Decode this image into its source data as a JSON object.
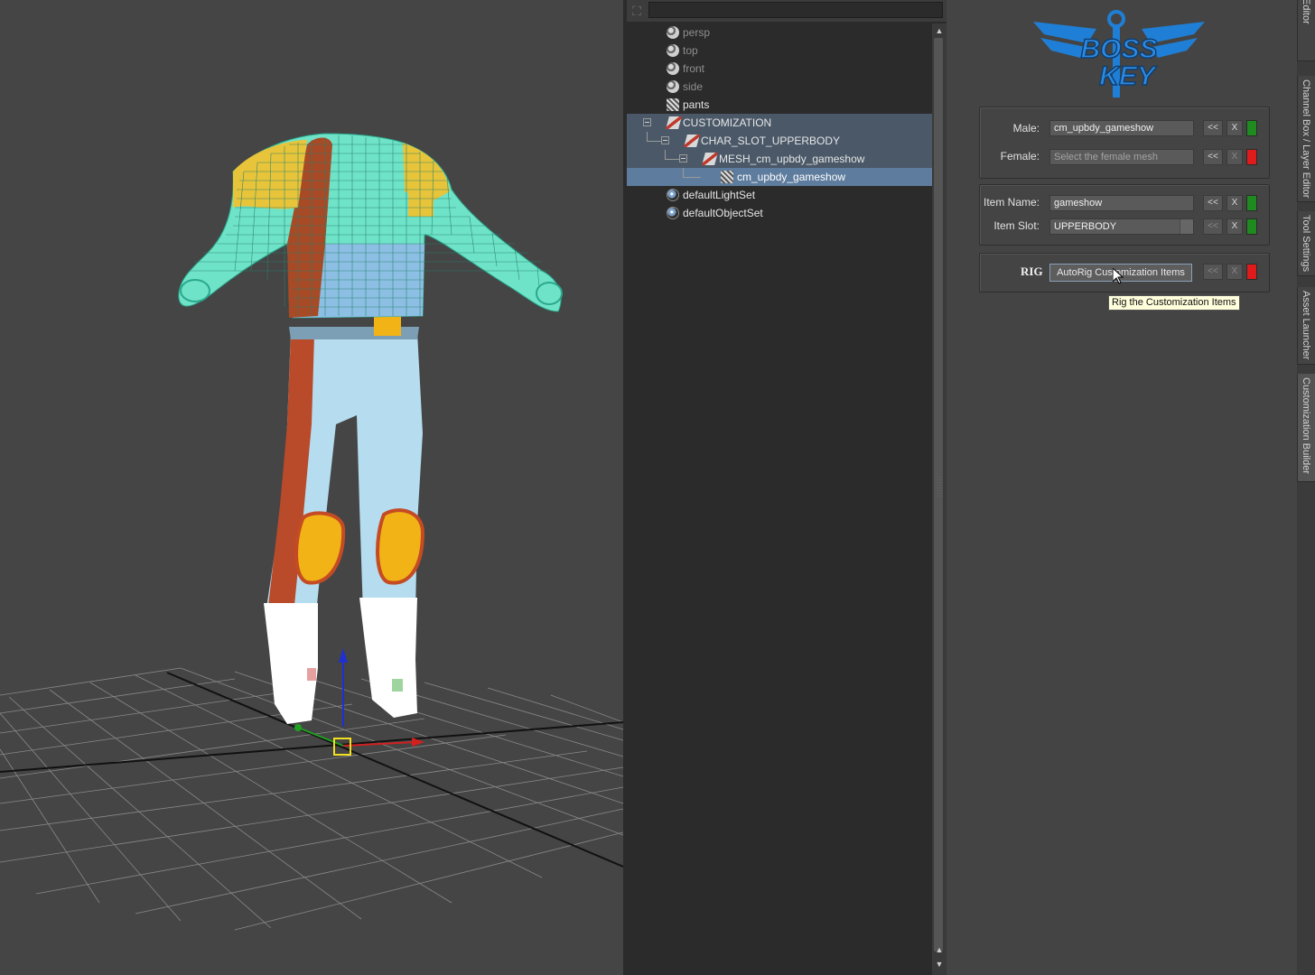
{
  "outliner": {
    "search_placeholder": "",
    "items": [
      {
        "label": "persp",
        "type": "camera"
      },
      {
        "label": "top",
        "type": "camera"
      },
      {
        "label": "front",
        "type": "camera"
      },
      {
        "label": "side",
        "type": "camera"
      },
      {
        "label": "pants",
        "type": "mesh"
      },
      {
        "label": "CUSTOMIZATION",
        "type": "group"
      },
      {
        "label": "CHAR_SLOT_UPPERBODY",
        "type": "group"
      },
      {
        "label": "MESH_cm_upbdy_gameshow",
        "type": "group"
      },
      {
        "label": "cm_upbdy_gameshow",
        "type": "mesh",
        "selected": true
      },
      {
        "label": "defaultLightSet",
        "type": "set"
      },
      {
        "label": "defaultObjectSet",
        "type": "set"
      }
    ]
  },
  "panel": {
    "logo_line1": "BOSS",
    "logo_line2": "KEY",
    "male_label": "Male:",
    "male_value": "cm_upbdy_gameshow",
    "female_label": "Female:",
    "female_placeholder": "Select the female mesh",
    "item_name_label": "Item Name:",
    "item_name_value": "gameshow",
    "item_slot_label": "Item Slot:",
    "item_slot_value": "UPPERBODY",
    "rig_label": "RIG",
    "rig_button": "AutoRig Customization Items",
    "tooltip": "Rig the Customization Items",
    "back_label": "<<",
    "clear_label": "X",
    "status_colors": {
      "ok": "#1f8a1f",
      "error": "#e01b1b"
    }
  },
  "side_tabs": [
    "Attribute Editor",
    "Channel Box / Layer Editor",
    "Tool Settings",
    "Asset Launcher",
    "Customization Builder"
  ],
  "accent": "#5e7c9d"
}
